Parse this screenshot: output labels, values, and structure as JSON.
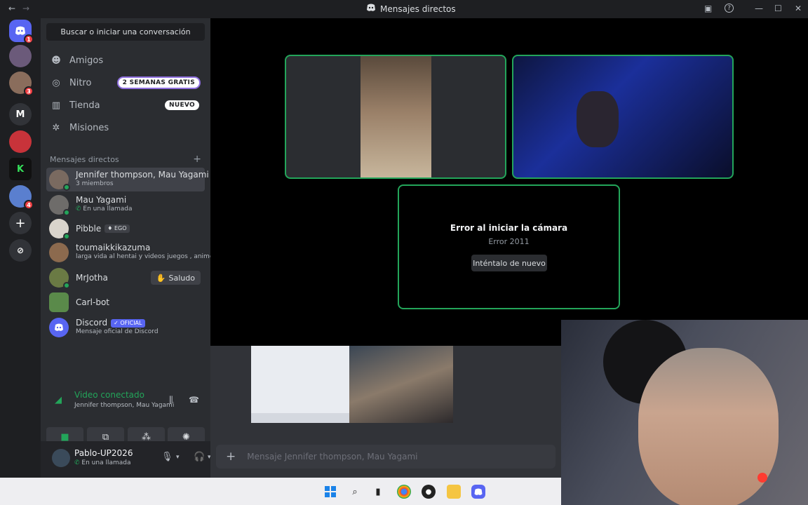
{
  "window": {
    "title": "Mensajes directos",
    "controls": [
      "minimize-icon",
      "maximize-icon",
      "close-icon"
    ]
  },
  "rail": {
    "servers": [
      {
        "name": "discord-home",
        "badge": "1"
      },
      {
        "name": "server-group",
        "badge": ""
      },
      {
        "name": "server-avatar",
        "badge": "3"
      },
      {
        "name": "server-m",
        "label": "M"
      },
      {
        "name": "server-red",
        "badge": ""
      },
      {
        "name": "server-k",
        "badge": ""
      },
      {
        "name": "server-minecraft",
        "badge": "4"
      }
    ],
    "add_server_icon": "+",
    "explore_icon": "compass-icon"
  },
  "sidebar": {
    "search_label": "Buscar o iniciar una conversación",
    "nav": [
      {
        "label": "Amigos",
        "icon": "friends-icon"
      },
      {
        "label": "Nitro",
        "icon": "nitro-icon",
        "pill": "2 SEMANAS GRATIS"
      },
      {
        "label": "Tienda",
        "icon": "shop-icon",
        "pill": "NUEVO"
      },
      {
        "label": "Misiones",
        "icon": "quests-icon"
      }
    ],
    "dm_header": "Mensajes directos",
    "dms": [
      {
        "name": "Jennifer thompson, Mau Yagami",
        "sub": "3 miembros",
        "active": true
      },
      {
        "name": "Mau Yagami",
        "sub": "En una llamada"
      },
      {
        "name": "Pibble",
        "tag": "EGO"
      },
      {
        "name": "toumaikkikazuma",
        "sub": "larga vida al hentai y videos juegos , anime"
      },
      {
        "name": "MrJotha",
        "action": "Saludo"
      },
      {
        "name": "Carl-bot"
      },
      {
        "name": "Discord",
        "tag": "✓ OFICIAL",
        "sub": "Mensaje oficial de Discord"
      }
    ]
  },
  "voice": {
    "status": "Video conectado",
    "channel": "Jennifer thompson, Mau Yagami"
  },
  "user": {
    "name": "Pablo-UP2026",
    "status": "En una llamada"
  },
  "call": {
    "error_title": "Error al iniciar la cámara",
    "error_code": "Error 2011",
    "retry_label": "Inténtalo de nuevo"
  },
  "composer": {
    "placeholder": "Mensaje Jennifer thompson, Mau Yagami"
  },
  "colors": {
    "accent": "#5865f2",
    "online": "#23a55a",
    "danger": "#f23f43"
  }
}
